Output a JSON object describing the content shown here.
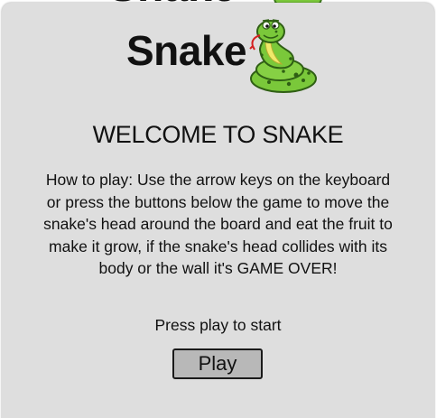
{
  "background": {
    "title": "Snake"
  },
  "modal": {
    "logo_text": "Snake",
    "logo_icon": "snake-icon",
    "heading": "WELCOME TO SNAKE",
    "instructions": "How to play: Use the arrow keys on the keyboard or press the buttons below the game to move the snake's head around the board and eat the fruit to make it grow, if the snake's head collides with its body or the wall it's GAME OVER!",
    "prompt": "Press play to start",
    "play_button_label": "Play"
  },
  "colors": {
    "modal_background": "#dedede",
    "button_background": "#b8b8b8",
    "snake_green": "#7ac83a",
    "snake_dark_green": "#3d7a1c",
    "snake_belly": "#f0e96a"
  }
}
